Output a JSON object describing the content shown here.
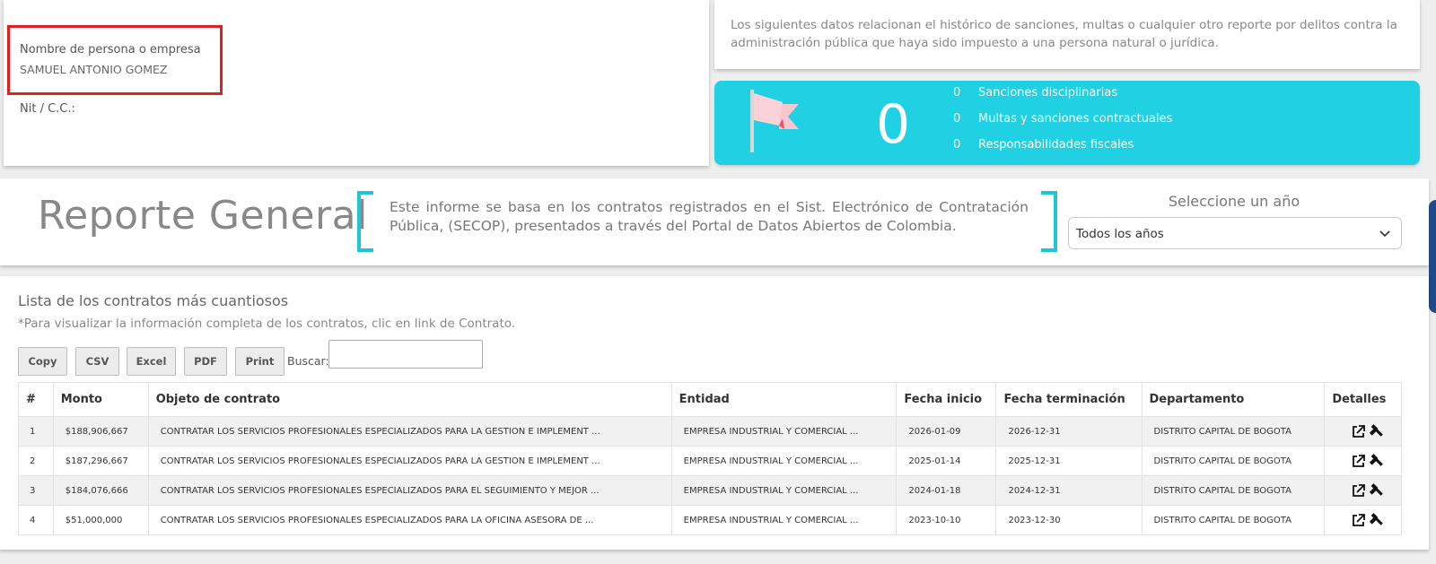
{
  "person": {
    "name_label": "Nombre de persona o empresa",
    "name_value": "SAMUEL ANTONIO GOMEZ",
    "nit_label": "Nit / C.C.:"
  },
  "intro": {
    "text": "Los siguientes datos relacionan el histórico de sanciones, multas o cualquier otro reporte por delitos contra la administración pública que haya sido impuesto a una persona natural o jurídica."
  },
  "sanctions": {
    "total": "0",
    "flag_icon": "flag-icon",
    "items": [
      {
        "count": "0",
        "label": "Sanciones disciplinarias"
      },
      {
        "count": "0",
        "label": "Multas y sanciones contractuales"
      },
      {
        "count": "0",
        "label": "Responsabilidades fiscales"
      }
    ],
    "accent": "#1fd1e2"
  },
  "report": {
    "title": "Reporte General",
    "description": "Este informe se basa en los contratos registrados en el Sist. Electrónico de Contratación Pública, (SECOP), presentados a través del Portal de Datos Abiertos de Colombia.",
    "year_label": "Seleccione un año",
    "year_selected": "Todos los años"
  },
  "contracts": {
    "title": "Lista de los contratos más cuantiosos",
    "hint": "*Para visualizar la información completa de los contratos, clic en link de Contrato.",
    "buttons": {
      "copy": "Copy",
      "csv": "CSV",
      "excel": "Excel",
      "pdf": "PDF",
      "print": "Print"
    },
    "search_label": "Buscar:",
    "search_value": "",
    "columns": [
      "#",
      "Monto",
      "Objeto de contrato",
      "Entidad",
      "Fecha inicio",
      "Fecha terminación",
      "Departamento",
      "Detalles"
    ],
    "rows": [
      {
        "idx": "1",
        "monto": "$188,906,667",
        "objeto": "CONTRATAR LOS SERVICIOS PROFESIONALES ESPECIALIZADOS PARA LA GESTION E IMPLEMENT ...",
        "entidad": "EMPRESA INDUSTRIAL Y COMERCIAL ...",
        "inicio": "2026-01-09",
        "fin": "2026-12-31",
        "depto": "DISTRITO CAPITAL DE BOGOTA"
      },
      {
        "idx": "2",
        "monto": "$187,296,667",
        "objeto": "CONTRATAR LOS SERVICIOS PROFESIONALES ESPECIALIZADOS PARA LA GESTION E IMPLEMENT ...",
        "entidad": "EMPRESA INDUSTRIAL Y COMERCIAL ...",
        "inicio": "2025-01-14",
        "fin": "2025-12-31",
        "depto": "DISTRITO CAPITAL DE BOGOTA"
      },
      {
        "idx": "3",
        "monto": "$184,076,666",
        "objeto": "CONTRATAR LOS SERVICIOS PROFESIONALES ESPECIALIZADOS PARA EL SEGUIMIENTO Y MEJOR ...",
        "entidad": "EMPRESA INDUSTRIAL Y COMERCIAL ...",
        "inicio": "2024-01-18",
        "fin": "2024-12-31",
        "depto": "DISTRITO CAPITAL DE BOGOTA"
      },
      {
        "idx": "4",
        "monto": "$51,000,000",
        "objeto": "CONTRATAR LOS SERVICIOS PROFESIONALES ESPECIALIZADOS PARA LA OFICINA ASESORA DE ...",
        "entidad": "EMPRESA INDUSTRIAL Y COMERCIAL ...",
        "inicio": "2023-10-10",
        "fin": "2023-12-30",
        "depto": "DISTRITO CAPITAL DE BOGOTA"
      }
    ],
    "detail_icons": [
      "external-link-icon",
      "gavel-icon"
    ]
  }
}
